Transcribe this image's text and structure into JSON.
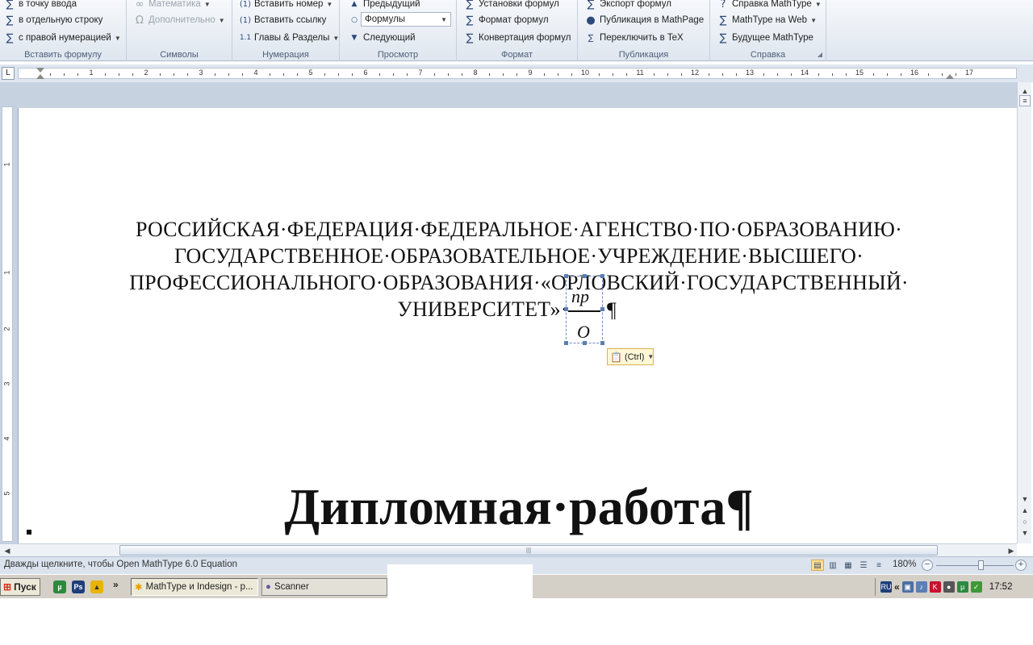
{
  "ribbon": {
    "insert_group": {
      "label": "Вставить формулу",
      "items": [
        "в точку ввода",
        "в отдельную строку",
        "с правой нумерацией"
      ]
    },
    "symbols_group": {
      "label": "Символы",
      "items": [
        "Математика",
        "Дополнительно"
      ]
    },
    "numbering_group": {
      "label": "Нумерация",
      "items": [
        "Вставить номер",
        "Вставить ссылку",
        "Главы & Разделы"
      ]
    },
    "view_group": {
      "label": "Просмотр",
      "items": [
        "Предыдущий",
        "Формулы",
        "Следующий"
      ]
    },
    "format_group": {
      "label": "Формат",
      "items": [
        "Установки формул",
        "Формат формул",
        "Конвертация формул"
      ]
    },
    "publish_group": {
      "label": "Публикация",
      "items": [
        "Экспорт формул",
        "Публикация в MathPage",
        "Переключить в TeX"
      ]
    },
    "help_group": {
      "label": "Справка",
      "items": [
        "Справка MathType",
        "MathType на Web",
        "Будущее MathType"
      ]
    }
  },
  "ruler": {
    "tab_selector": "L",
    "labels": [
      "1",
      "2",
      "3",
      "4",
      "5",
      "6",
      "7",
      "8",
      "9",
      "10",
      "11",
      "12",
      "13",
      "14",
      "15",
      "16",
      "17"
    ],
    "vertical_labels": [
      "1",
      "1",
      "2",
      "3",
      "4",
      "5"
    ]
  },
  "document": {
    "org_lines": [
      "РОССИЙСКАЯ·ФЕДЕРАЦИЯ·ФЕДЕРАЛЬНОЕ·АГЕНСТВО·ПО·ОБРАЗОВАНИЮ·",
      "ГОСУДАРСТВЕННОЕ·ОБРАЗОВАТЕЛЬНОЕ·УЧРЕЖДЕНИЕ·ВЫСШЕГО·",
      "ПРОФЕССИОНАЛЬНОГО·ОБРАЗОВАНИЯ·«ОРЛОВСКИЙ·ГОСУДАРСТВЕННЫЙ·",
      "УНИВЕРСИТЕТ»·"
    ],
    "equation": {
      "numerator": "пр",
      "denominator": "О"
    },
    "pilcrow": "¶",
    "paste_options": "(Ctrl)",
    "title": "Дипломная·работа¶"
  },
  "status_bar": {
    "text": "Дважды щелкните, чтобы Open MathType 6.0 Equation",
    "zoom": "180%",
    "zoom_minus": "−",
    "zoom_plus": "+",
    "zoom_level_percent": 180
  },
  "taskbar": {
    "start_label": "Пуск",
    "overflow": "»",
    "tasks": [
      "MathType и Indesign - p...",
      "Scanner"
    ],
    "language": "RU",
    "tray_overflow": "«",
    "clock": "17:52"
  },
  "colors": {
    "ribbon_bg": "#dfe6ef",
    "doc_bg": "#c7d2e1",
    "selection": "#5b7fb6",
    "paste_bg": "#fff8d8"
  }
}
